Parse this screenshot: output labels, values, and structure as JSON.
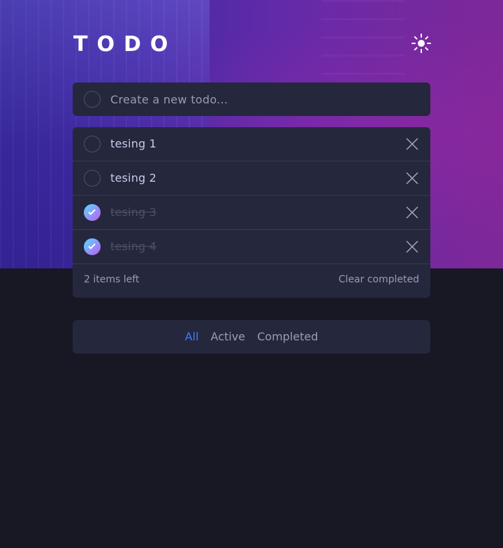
{
  "header": {
    "title": "TODO",
    "theme_icon": "sun-icon"
  },
  "new_todo": {
    "placeholder": "Create a new todo...",
    "value": ""
  },
  "todos": [
    {
      "text": "tesing 1",
      "completed": false
    },
    {
      "text": "tesing 2",
      "completed": false
    },
    {
      "text": "tesing 3",
      "completed": true
    },
    {
      "text": "tesing 4",
      "completed": true
    }
  ],
  "footer": {
    "items_left": "2 items left",
    "clear_label": "Clear completed"
  },
  "filters": {
    "all": "All",
    "active": "Active",
    "completed": "Completed",
    "selected": "All"
  },
  "colors": {
    "background": "#171823",
    "card": "#25273d",
    "active_filter": "#3a7cfd",
    "check_gradient_start": "#55ddff",
    "check_gradient_end": "#c058f3"
  }
}
